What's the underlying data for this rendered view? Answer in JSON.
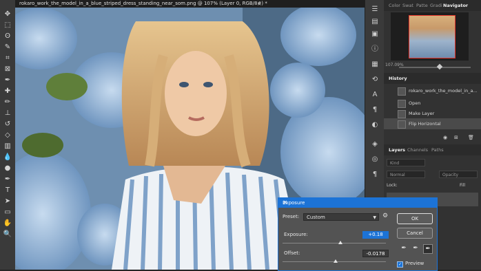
{
  "document": {
    "tab_title": "rokaro_work_the_model_in_a_blue_striped_dress_standing_near_som.png @ 107% (Layer 0, RGB/8#) *",
    "close_glyph": "×"
  },
  "toolbar": {
    "tools": [
      "move-tool",
      "marquee-tool",
      "lasso-tool",
      "quick-select-tool",
      "crop-tool",
      "frame-tool",
      "eyedropper-tool",
      "healing-brush-tool",
      "brush-tool",
      "clone-stamp-tool",
      "history-brush-tool",
      "eraser-tool",
      "gradient-tool",
      "blur-tool",
      "dodge-tool",
      "pen-tool",
      "type-tool",
      "path-select-tool",
      "rectangle-tool",
      "hand-tool",
      "zoom-tool"
    ],
    "glyphs": [
      "✥",
      "⬚",
      "ʘ",
      "✎",
      "⌗",
      "⊠",
      "✒",
      "✚",
      "✏",
      "⊥",
      "↺",
      "◇",
      "▥",
      "💧",
      "●",
      "✒",
      "T",
      "➤",
      "▭",
      "✋",
      "🔍"
    ]
  },
  "panels": {
    "top_tabs": [
      "Color",
      "Swat",
      "Patte",
      "Gradi",
      "Navigator"
    ],
    "zoom_label": "107.09%",
    "history": {
      "tab": "History",
      "snapshot": "rokaro_work_the_model_in_a...",
      "items": [
        "Open",
        "Make Layer",
        "Flip Horizontal"
      ]
    },
    "layers": {
      "tabs": [
        "Layers",
        "Channels",
        "Paths"
      ],
      "kind_placeholder": "Kind",
      "blend_mode": "Normal",
      "opacity_label": "Opacity",
      "lock_label": "Lock:",
      "fill_label": "Fill"
    }
  },
  "dialog": {
    "title": "Exposure",
    "close_glyph": "×",
    "preset_label": "Preset:",
    "preset_value": "Custom",
    "exposure_label": "Exposure:",
    "exposure_value": "+0.18",
    "offset_label": "Offset:",
    "offset_value": "-0.0178",
    "ok_label": "OK",
    "cancel_label": "Cancel",
    "preview_label": "Preview"
  },
  "colors": {
    "accent": "#1c73d6",
    "panel": "#323232",
    "navigator_frame": "#e8342a"
  }
}
